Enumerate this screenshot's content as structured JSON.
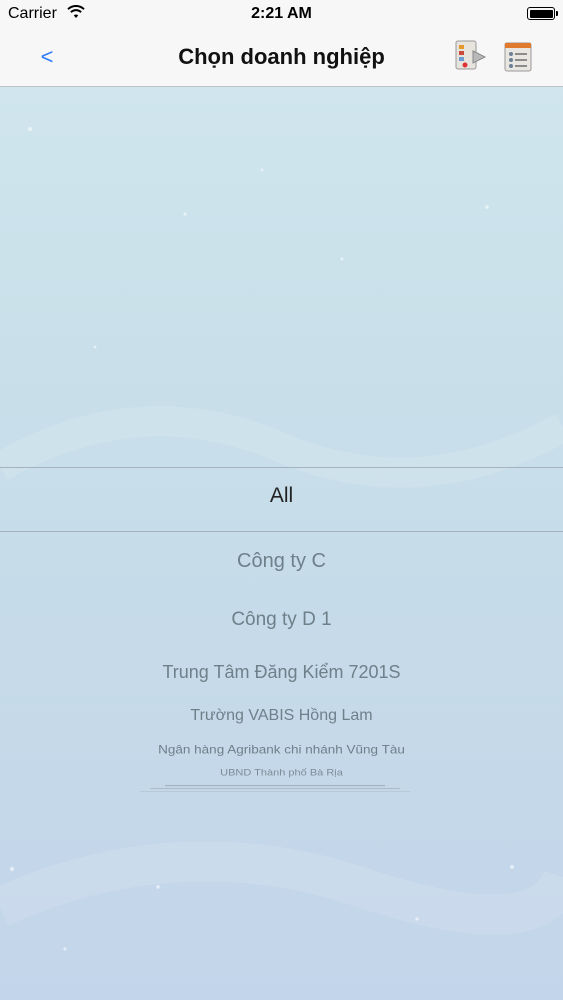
{
  "status_bar": {
    "carrier": "Carrier",
    "time": "2:21 AM"
  },
  "nav": {
    "back_label": "<",
    "title": "Chọn doanh nghiệp",
    "icons": [
      "document-export-icon",
      "list-document-icon"
    ]
  },
  "picker": {
    "selected": "All",
    "options": [
      "Công ty C",
      "Công ty D 1",
      "Trung Tâm Đăng Kiểm 7201S",
      "Trường VABIS Hồng Lam",
      "Ngân hàng Agribank chi nhánh Vũng Tàu",
      "UBND Thành phố Bà Rịa"
    ]
  },
  "colors": {
    "accent": "#2e7cf6",
    "nav_background": "#f7f7f7",
    "picker_selected_text": "#222222",
    "picker_option_text": "#6e8089"
  }
}
